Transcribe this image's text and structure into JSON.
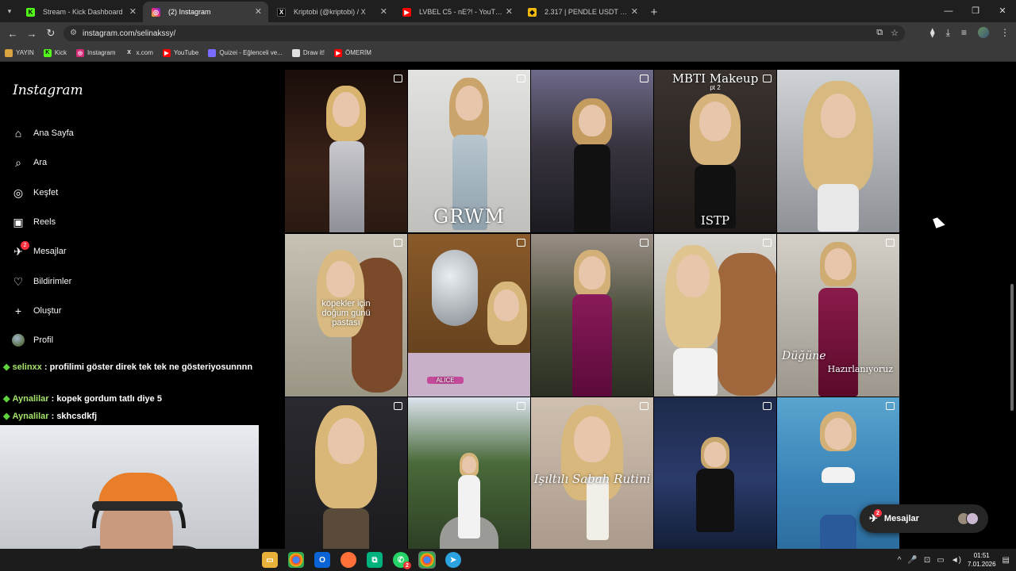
{
  "browser": {
    "tabs": [
      {
        "label": "Stream - Kick Dashboard",
        "fav_text": "K",
        "fav_color": "#53fc18",
        "active": false
      },
      {
        "label": "(2) Instagram",
        "fav_text": "◎",
        "fav_color": "#d62976",
        "active": true
      },
      {
        "label": "Kriptobi (@kriptobi) / X",
        "fav_text": "X",
        "fav_color": "#000000",
        "active": false
      },
      {
        "label": "LVBEL C5 - nE?! - YouTube",
        "fav_text": "▶",
        "fav_color": "#ff0000",
        "active": false
      },
      {
        "label": "2.317 | PENDLE USDT | Pendle",
        "fav_text": "◆",
        "fav_color": "#f0b90b",
        "active": false
      }
    ],
    "url": "instagram.com/selinakssy/",
    "bookmarks": [
      {
        "label": "YAYIN",
        "icon": "folder-icon",
        "color": "#d9a441"
      },
      {
        "label": "Kick",
        "icon": "kick-icon",
        "color": "#53fc18"
      },
      {
        "label": "Instagram",
        "icon": "instagram-icon",
        "color": "#d62976"
      },
      {
        "label": "x.com",
        "icon": "x-icon",
        "color": "#000000"
      },
      {
        "label": "YouTube",
        "icon": "youtube-icon",
        "color": "#ff0000"
      },
      {
        "label": "Quizei - Eğlenceli ve...",
        "icon": "quiz-icon",
        "color": "#7a6cff"
      },
      {
        "label": "Draw it!",
        "icon": "draw-icon",
        "color": "#e0e0e0"
      },
      {
        "label": "ÖMERİM",
        "icon": "youtube-icon",
        "color": "#ff0000"
      }
    ]
  },
  "instagram": {
    "logo": "Instagram",
    "nav": [
      {
        "label": "Ana Sayfa",
        "icon": "home-icon",
        "glyph": "⌂"
      },
      {
        "label": "Ara",
        "icon": "search-icon",
        "glyph": "⌕"
      },
      {
        "label": "Keşfet",
        "icon": "explore-icon",
        "glyph": "◎"
      },
      {
        "label": "Reels",
        "icon": "reels-icon",
        "glyph": "▣"
      },
      {
        "label": "Mesajlar",
        "icon": "messenger-icon",
        "glyph": "✈",
        "badge": "2"
      },
      {
        "label": "Bildirimler",
        "icon": "heart-icon",
        "glyph": "♡"
      },
      {
        "label": "Oluştur",
        "icon": "plus-icon",
        "glyph": "+"
      },
      {
        "label": "Profil",
        "icon": "profile-avatar-icon",
        "glyph": ""
      }
    ],
    "grid_overlays": {
      "r1c2": "GRWM",
      "r1c4_top": "MBTI Makeup",
      "r1c4_sub": "pt 2",
      "r1c4_bottom": "ISTP",
      "r2c1": "köpekler için doğum günü pastası",
      "r2c2": "ALICE",
      "r2c5_a": "Düğüne",
      "r2c5_b": "Hazırlanıyoruz",
      "r3c3": "Işıltılı Sabah Rutini"
    },
    "messages_pill": {
      "label": "Mesajlar",
      "badge": "2"
    }
  },
  "chat": [
    {
      "user": "selinxx",
      "text": ": profilimi göster direk tek tek ne gösteriyosunnnn"
    },
    {
      "user": "Aynalilar",
      "text": ": kopek gordum tatlı diye 5"
    },
    {
      "user": "Aynalilar",
      "text": ": skhcsdkfj"
    }
  ],
  "taskbar": {
    "time": "01:51",
    "date": "7.01.2026",
    "whatsapp_badge": "2"
  }
}
